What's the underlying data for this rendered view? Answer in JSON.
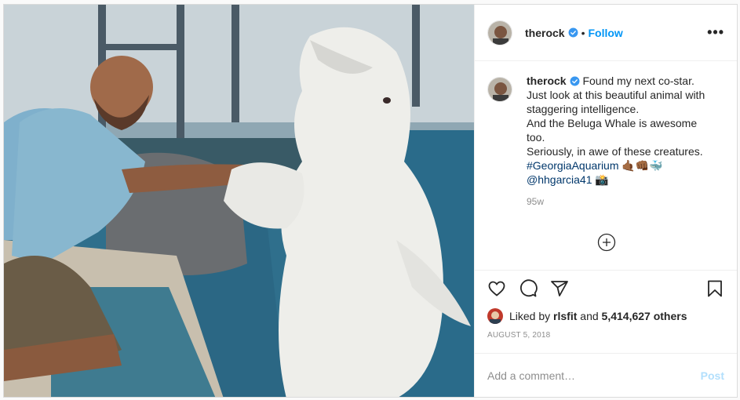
{
  "post": {
    "image_alt": "Man in a blue t-shirt shaking flippers with a white beluga whale at an aquarium pool",
    "author": "therock",
    "follow_label": "Follow",
    "dot": "•",
    "more_label": "•••",
    "caption": {
      "username": "therock",
      "lines": [
        "Found my next co-star.",
        "Just look at this beautiful animal with staggering intelligence.",
        "And the Beluga Whale is awesome too.",
        "Seriously, in awe of these creatures."
      ],
      "hashtag": "#GeorgiaAquarium",
      "hashtag_emoji": " 🤙🏾👊🏾🐳",
      "mention": "@hhgarcia41",
      "mention_emoji": " 📸"
    },
    "age": "95w",
    "likes": {
      "prefix": "Liked by ",
      "user": "rlsfit",
      "middle": " and ",
      "count": "5,414,627 others"
    },
    "date": "AUGUST 5, 2018",
    "comment_placeholder": "Add a comment…",
    "post_label": "Post"
  },
  "colors": {
    "accent": "#0095f6",
    "post_disabled": "#b2dffc",
    "verified": "#3897f0"
  }
}
